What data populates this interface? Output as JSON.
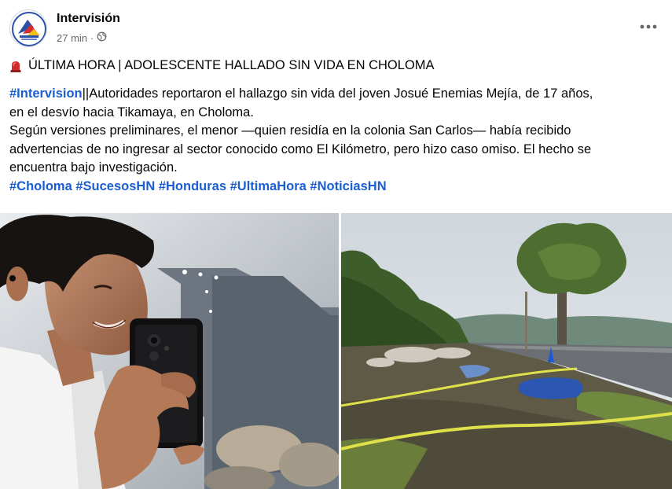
{
  "post": {
    "page_name": "Intervisión",
    "timestamp": "27 min",
    "separator": "·",
    "audience_icon": "globe-icon",
    "more_icon": "more-horizontal-icon",
    "title_icon": "siren-icon",
    "title": "ÚLTIMA HORA | ADOLESCENTE HALLADO SIN VIDA EN CHOLOMA",
    "body": {
      "lead_hashtag": "#Intervision",
      "line1_rest": "||Autoridades reportaron el hallazgo sin vida del joven Josué Enemias Mejía, de 17 años,",
      "line2": "en el desvío hacia Tikamaya, en Choloma.",
      "paragraph2_line1": "Según versiones preliminares, el menor —quien residía en la colonia San Carlos— había recibido",
      "paragraph2_line2": "advertencias de no ingresar al sector conocido como El Kilómetro, pero hizo caso omiso. El hecho se",
      "paragraph2_line3": "encuentra bajo investigación.",
      "hashtags": [
        "#Choloma",
        "#SucesosHN",
        "#Honduras",
        "#UltimaHora",
        "#NoticiasHN"
      ]
    }
  },
  "colors": {
    "hashtag": "#1a5ecf",
    "secondary_text": "#65676b",
    "primary_text": "#050505"
  }
}
